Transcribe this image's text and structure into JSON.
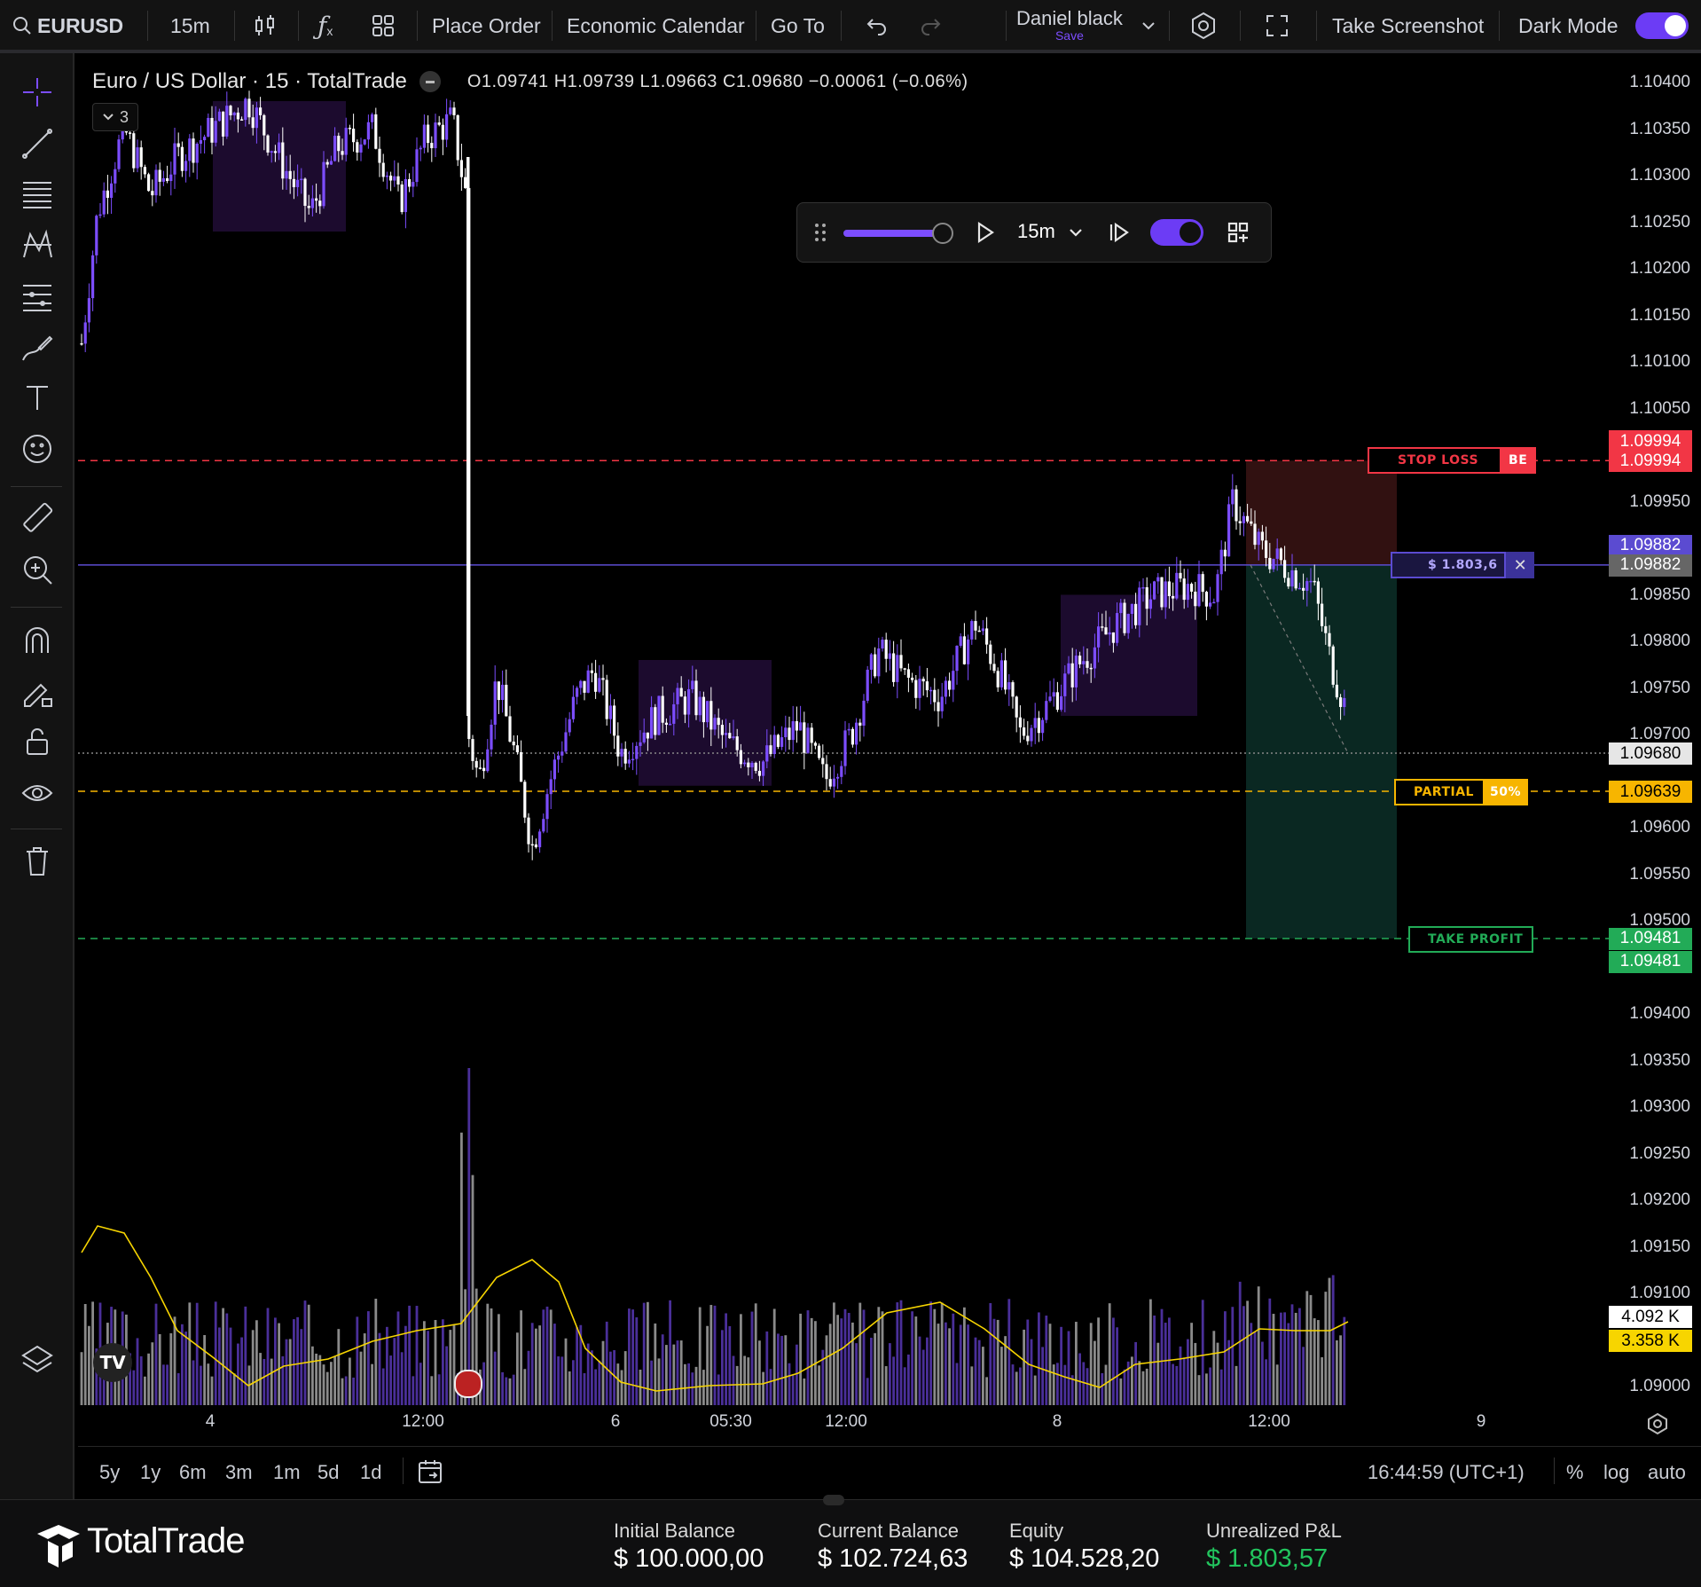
{
  "topbar": {
    "symbol": "EURUSD",
    "interval": "15m",
    "place_order": "Place Order",
    "economic_calendar": "Economic Calendar",
    "go_to": "Go To",
    "user_name": "Daniel black",
    "user_save": "Save",
    "take_screenshot": "Take Screenshot",
    "dark_mode": "Dark Mode"
  },
  "legend": {
    "title": "Euro / US Dollar · 15 · TotalTrade",
    "ohlc": "O1.09741  H1.09739  L1.09663  C1.09680  −0.00061 (−0.06%)",
    "indicator_count": "3"
  },
  "replay": {
    "interval": "15m"
  },
  "price_axis": {
    "ticks": [
      "1.10400",
      "1.10350",
      "1.10300",
      "1.10250",
      "1.10200",
      "1.10150",
      "1.10100",
      "1.10050",
      "1.09950",
      "1.09850",
      "1.09800",
      "1.09750",
      "1.09700",
      "1.09600",
      "1.09550",
      "1.09500",
      "1.09400",
      "1.09350",
      "1.09300",
      "1.09250",
      "1.09200",
      "1.09150",
      "1.09100",
      "1.09000"
    ],
    "stop_loss_top": "1.09994",
    "stop_loss": "1.09994",
    "entry_top": "1.09882",
    "entry": "1.09882",
    "current": "1.09680",
    "partial": "1.09639",
    "take_profit": "1.09481",
    "take_profit_bottom": "1.09481",
    "volume": "4.092 K",
    "volume_ma": "3.358 K"
  },
  "orders": {
    "stop_loss_label": "STOP LOSS",
    "be_label": "BE",
    "position_pnl": "$ 1.803,6",
    "partial_label": "PARTIAL",
    "partial_pct": "50%",
    "take_profit_label": "TAKE PROFIT"
  },
  "time_axis": [
    "4",
    "12:00",
    "6",
    "05:30",
    "12:00",
    "8",
    "12:00",
    "9"
  ],
  "range_bar": {
    "ranges": [
      "5y",
      "1y",
      "6m",
      "3m",
      "1m",
      "5d",
      "1d"
    ],
    "clock": "16:44:59 (UTC+1)",
    "percent": "%",
    "log": "log",
    "auto": "auto"
  },
  "footer": {
    "brand": "TotalTrade",
    "initial_balance_label": "Initial Balance",
    "initial_balance": "$ 100.000,00",
    "current_balance_label": "Current Balance",
    "current_balance": "$ 102.724,63",
    "equity_label": "Equity",
    "equity": "$ 104.528,20",
    "unrealized_label": "Unrealized P&L",
    "unrealized": "$ 1.803,57"
  },
  "colors": {
    "accent": "#7c4dff",
    "stop_loss": "#f23645",
    "take_profit": "#22ab57",
    "partial": "#f7b500",
    "entry": "#5b4bd1",
    "candle_bull": "#7c4dff",
    "candle_bear": "#ffffff"
  }
}
